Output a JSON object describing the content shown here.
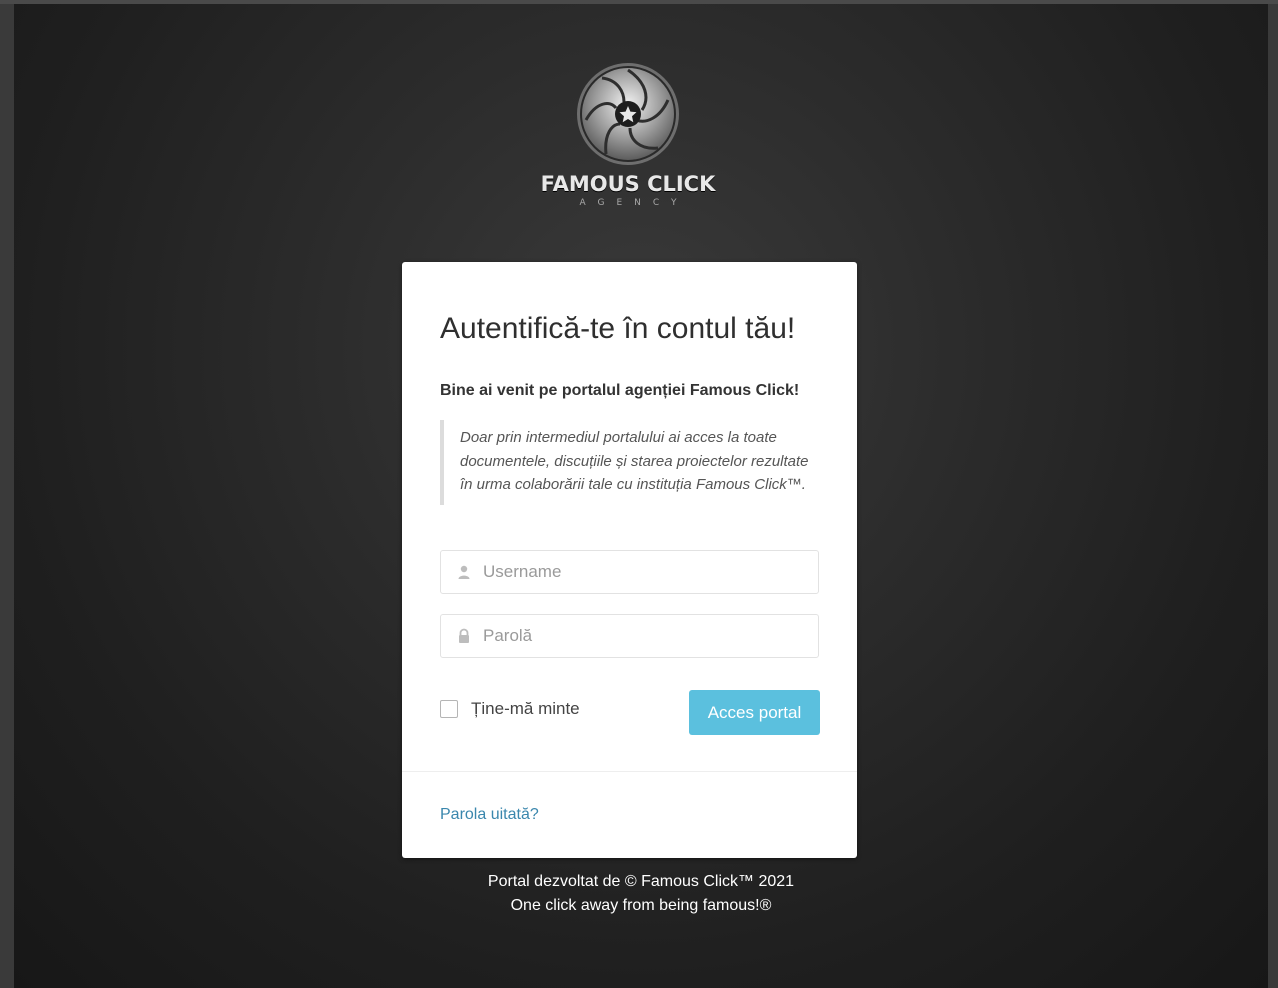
{
  "brand": {
    "name": "FAMOUS CLICK",
    "tagline": "AGENCY"
  },
  "login": {
    "title": "Autentifică-te în contul tău!",
    "welcome": "Bine ai venit pe portalul agenției Famous Click!",
    "description": "Doar prin intermediul portalului ai acces la toate documentele, discuțiile și starea proiectelor rezultate în urma colaborării tale cu instituția Famous Click™.",
    "username": {
      "value": "",
      "placeholder": "Username",
      "icon": "user-icon"
    },
    "password": {
      "value": "",
      "placeholder": "Parolă",
      "icon": "lock-icon"
    },
    "remember_label": "Ține-mă minte",
    "remember_checked": false,
    "submit_label": "Acces portal",
    "forgot_link": "Parola uitată?"
  },
  "footer": {
    "line1": "Portal dezvoltat de © Famous Click™ 2021",
    "line2": "One click away from being famous!®"
  },
  "colors": {
    "button": "#5bc0de",
    "link": "#3a87ad",
    "card": "#ffffff"
  }
}
